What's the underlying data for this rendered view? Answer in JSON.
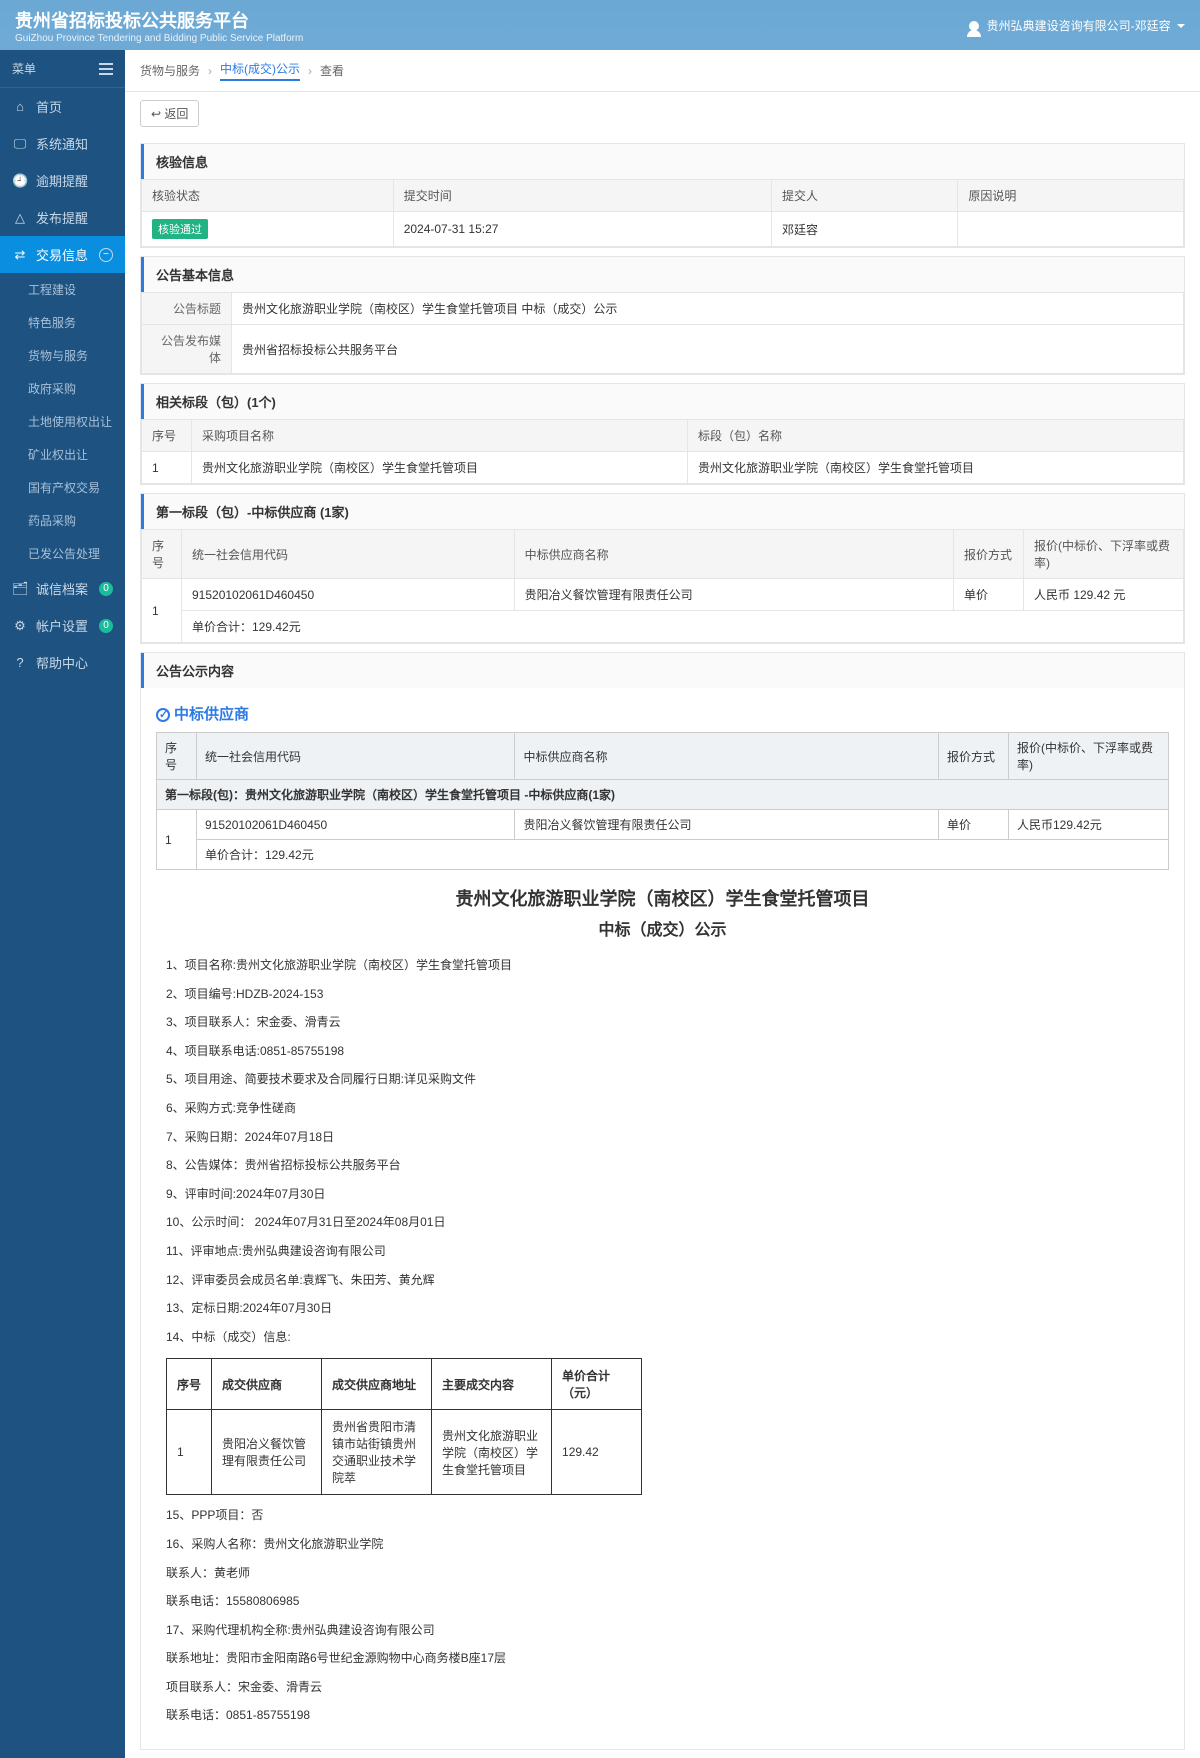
{
  "header": {
    "title": "贵州省招标投标公共服务平台",
    "subtitle": "GuiZhou Province Tendering and Bidding Public Service Platform",
    "user": "贵州弘典建设咨询有限公司-邓廷容"
  },
  "sidebar": {
    "menu_label": "菜单",
    "items": [
      {
        "icon": "⌂",
        "label": "首页"
      },
      {
        "icon": "🖵",
        "label": "系统通知"
      },
      {
        "icon": "🕘",
        "label": "逾期提醒"
      },
      {
        "icon": "△",
        "label": "发布提醒"
      },
      {
        "icon": "⇄",
        "label": "交易信息",
        "active": true,
        "expand": "−"
      },
      {
        "icon": "🗂",
        "label": "诚信档案",
        "badge": "0"
      },
      {
        "icon": "⚙",
        "label": "帐户设置",
        "badge": "0"
      },
      {
        "icon": "?",
        "label": "帮助中心"
      }
    ],
    "subs": [
      "工程建设",
      "特色服务",
      "货物与服务",
      "政府采购",
      "土地使用权出让",
      "矿业权出让",
      "国有产权交易",
      "药品采购",
      "已发公告处理"
    ]
  },
  "breadcrumb": [
    "货物与服务",
    "中标(成交)公示",
    "查看"
  ],
  "btn_back": "返回",
  "verify": {
    "title": "核验信息",
    "headers": [
      "核验状态",
      "提交时间",
      "提交人",
      "原因说明"
    ],
    "row": {
      "status": "核验通过",
      "time": "2024-07-31 15:27",
      "person": "邓廷容",
      "reason": ""
    }
  },
  "basic": {
    "title": "公告基本信息",
    "rows": [
      {
        "label": "公告标题",
        "value": "贵州文化旅游职业学院（南校区）学生食堂托管项目 中标（成交）公示"
      },
      {
        "label": "公告发布媒体",
        "value": "贵州省招标投标公共服务平台"
      }
    ]
  },
  "packages": {
    "title": "相关标段（包）(1个)",
    "headers": [
      "序号",
      "采购项目名称",
      "标段（包）名称"
    ],
    "rows": [
      {
        "n": "1",
        "a": "贵州文化旅游职业学院（南校区）学生食堂托管项目",
        "b": "贵州文化旅游职业学院（南校区）学生食堂托管项目"
      }
    ]
  },
  "suppliers": {
    "title": "第一标段（包）-中标供应商 (1家)",
    "headers": [
      "序号",
      "统一社会信用代码",
      "中标供应商名称",
      "报价方式",
      "报价(中标价、下浮率或费率)"
    ],
    "row": {
      "n": "1",
      "code": "91520102061D460450",
      "name": "贵阳冶义餐饮管理有限责任公司",
      "mode": "单价",
      "price": "人民币 129.42 元"
    },
    "total": "单价合计：129.42元"
  },
  "notice": {
    "title": "公告公示内容",
    "winner_label": "中标供应商",
    "caption": "第一标段(包)：贵州文化旅游职业学院（南校区）学生食堂托管项目 -中标供应商(1家)",
    "headers": [
      "序号",
      "统一社会信用代码",
      "中标供应商名称",
      "报价方式",
      "报价(中标价、下浮率或费率)"
    ],
    "row": {
      "n": "1",
      "code": "91520102061D460450",
      "name": "贵阳冶义餐饮管理有限责任公司",
      "mode": "单价",
      "price": "人民币129.42元"
    },
    "total": "单价合计：129.42元"
  },
  "document": {
    "title": "贵州文化旅游职业学院（南校区）学生食堂托管项目",
    "subtitle": "中标（成交）公示",
    "lines": [
      "1、项目名称:贵州文化旅游职业学院（南校区）学生食堂托管项目",
      "2、项目编号:HDZB-2024-153",
      "3、项目联系人：宋金委、滑青云",
      "4、项目联系电话:0851-85755198",
      "5、项目用途、简要技术要求及合同履行日期:详见采购文件",
      "6、采购方式:竞争性磋商",
      "7、采购日期：2024年07月18日",
      "8、公告媒体：贵州省招标投标公共服务平台",
      "9、评审时间:2024年07月30日",
      "10、公示时间： 2024年07月31日至2024年08月01日",
      "11、评审地点:贵州弘典建设咨询有限公司",
      "12、评审委员会成员名单:袁辉飞、朱田芳、黄允辉",
      "13、定标日期:2024年07月30日",
      "14、中标（成交）信息:"
    ],
    "deal": {
      "headers": [
        "序号",
        "成交供应商",
        "成交供应商地址",
        "主要成交内容",
        "单价合计（元）"
      ],
      "row": {
        "n": "1",
        "a": "贵阳冶义餐饮管理有限责任公司",
        "b": "贵州省贵阳市清镇市站街镇贵州交通职业技术学院萃",
        "c": "贵州文化旅游职业学院（南校区）学生食堂托管项目",
        "d": "129.42"
      }
    },
    "after": [
      "15、PPP项目：否",
      "16、采购人名称：贵州文化旅游职业学院",
      "联系人：黄老师",
      "联系电话：15580806985",
      "17、采购代理机构全称:贵州弘典建设咨询有限公司",
      "联系地址：贵阳市金阳南路6号世纪金源购物中心商务楼B座17层",
      "项目联系人：宋金委、滑青云",
      "联系电话：0851-85755198"
    ]
  }
}
